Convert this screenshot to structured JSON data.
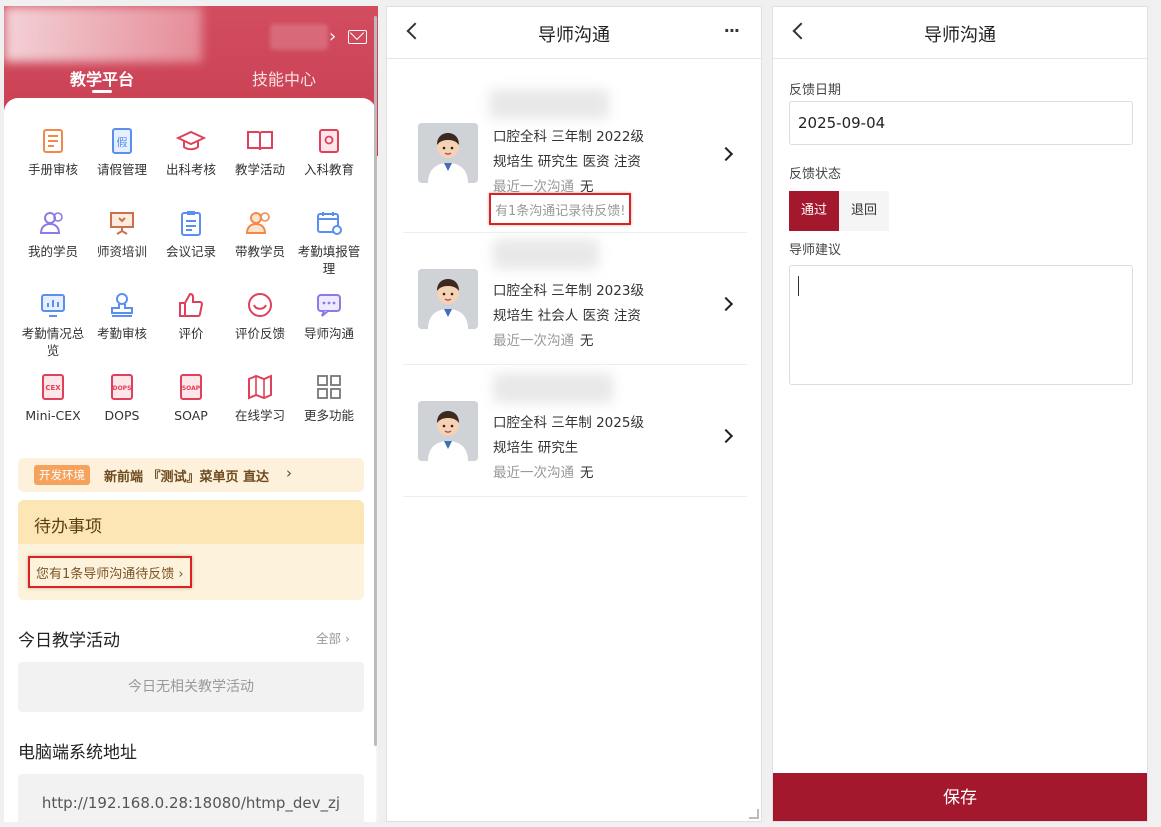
{
  "left_panel": {
    "tabs": [
      "教学平台",
      "技能中心"
    ],
    "grid_items": [
      {
        "label": "手册审核",
        "icon": "handbook-icon"
      },
      {
        "label": "请假管理",
        "icon": "leave-icon"
      },
      {
        "label": "出科考核",
        "icon": "graduation-cap-icon"
      },
      {
        "label": "教学活动",
        "icon": "open-book-icon"
      },
      {
        "label": "入科教育",
        "icon": "badge-book-icon"
      },
      {
        "label": "我的学员",
        "icon": "students-icon"
      },
      {
        "label": "师资培训",
        "icon": "presentation-icon"
      },
      {
        "label": "会议记录",
        "icon": "clipboard-icon"
      },
      {
        "label": "带教学员",
        "icon": "teaching-users-icon"
      },
      {
        "label": "考勤填报管理",
        "icon": "calendar-gear-icon"
      },
      {
        "label": "考勤情况总览",
        "icon": "bar-monitor-icon"
      },
      {
        "label": "考勤审核",
        "icon": "stamp-icon"
      },
      {
        "label": "评价",
        "icon": "thumbs-up-icon"
      },
      {
        "label": "评价反馈",
        "icon": "smile-icon"
      },
      {
        "label": "导师沟通",
        "icon": "chat-icon"
      },
      {
        "label": "Mini-CEX",
        "icon": "cex-doc-icon"
      },
      {
        "label": "DOPS",
        "icon": "dops-doc-icon"
      },
      {
        "label": "SOAP",
        "icon": "soap-doc-icon"
      },
      {
        "label": "在线学习",
        "icon": "map-icon"
      },
      {
        "label": "更多功能",
        "icon": "grid-more-icon"
      }
    ],
    "dev_tag": "开发环境",
    "dev_text": "新前端 『测试』菜单页 直达",
    "todo_title": "待办事项",
    "todo_item": "您有1条导师沟通待反馈",
    "today_title": "今日教学活动",
    "today_more": "全部",
    "today_empty": "今日无相关教学活动",
    "url_title": "电脑端系统地址",
    "url_value": "http://192.168.0.28:18080/htmp_dev_zj"
  },
  "middle_panel": {
    "title": "导师沟通",
    "more": "···",
    "students": [
      {
        "line1": "口腔全科 三年制 2022级",
        "line2": "规培生 研究生 医资 注资",
        "last_label": "最近一次沟通",
        "last_value": "无",
        "warning": "有1条沟通记录待反馈!"
      },
      {
        "line1": "口腔全科 三年制 2023级",
        "line2": "规培生 社会人 医资 注资",
        "last_label": "最近一次沟通",
        "last_value": "无"
      },
      {
        "line1": "口腔全科 三年制 2025级",
        "line2": "规培生 研究生",
        "last_label": "最近一次沟通",
        "last_value": "无"
      }
    ]
  },
  "right_panel": {
    "title": "导师沟通",
    "date_label": "反馈日期",
    "date_value": "2025-09-04",
    "status_label": "反馈状态",
    "status_options": [
      "通过",
      "退回"
    ],
    "advice_label": "导师建议",
    "save": "保存"
  },
  "colors": {
    "brand_red": "#c83c50",
    "dark_red": "#a3182d",
    "warning_border": "#e02020"
  }
}
